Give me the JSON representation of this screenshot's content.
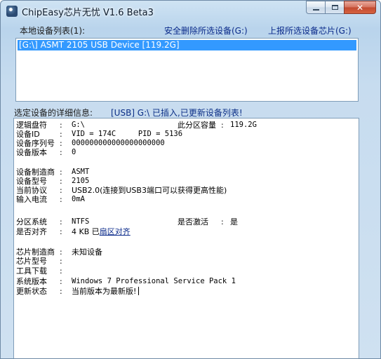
{
  "window": {
    "title": "ChipEasy芯片无忧 V1.6 Beta3",
    "close_glyph": "✕"
  },
  "toolbar": {
    "device_list_label": "本地设备列表(1):",
    "safe_remove_label": "安全删除所选设备(G:)",
    "report_chip_label": "上报所选设备芯片(G:)"
  },
  "device_list": {
    "items": [
      "[G:\\] ASMT 2105 USB Device [119.2G]"
    ]
  },
  "detail": {
    "label": "选定设备的详细信息:",
    "status": "[USB] G:\\ 已插入,已更新设备列表!",
    "colon": ":",
    "rows": {
      "logical_drive": {
        "key": "逻辑盘符",
        "value": "G:\\"
      },
      "partition_capacity": {
        "key": "此分区容量",
        "value": "119.2G"
      },
      "device_id": {
        "key": "设备ID",
        "value": "VID = 174C     PID = 5136"
      },
      "serial": {
        "key": "设备序列号",
        "value": "000000000000000000000"
      },
      "device_version": {
        "key": "设备版本",
        "value": "0"
      },
      "manufacturer": {
        "key": "设备制造商",
        "value": "ASMT"
      },
      "model": {
        "key": "设备型号",
        "value": "2105"
      },
      "protocol": {
        "key": "当前协议",
        "value": "USB2.0(连接到USB3端口可以获得更高性能)"
      },
      "current": {
        "key": "输入电流",
        "value": "0mA"
      },
      "filesystem": {
        "key": "分区系统",
        "value": "NTFS"
      },
      "activated": {
        "key": "是否激活",
        "value": "是"
      },
      "aligned": {
        "key": "是否对齐",
        "value": "4 KB 已",
        "link": "扇区对齐"
      },
      "chip_vendor": {
        "key": "芯片制造商",
        "value": "未知设备"
      },
      "chip_model": {
        "key": "芯片型号",
        "value": ""
      },
      "tool_download": {
        "key": "工具下载",
        "value": ""
      },
      "os_version": {
        "key": "系统版本",
        "value": "Windows 7 Professional Service Pack 1"
      },
      "update_status": {
        "key": "更新状态",
        "value": "当前版本为最新版!"
      }
    }
  }
}
